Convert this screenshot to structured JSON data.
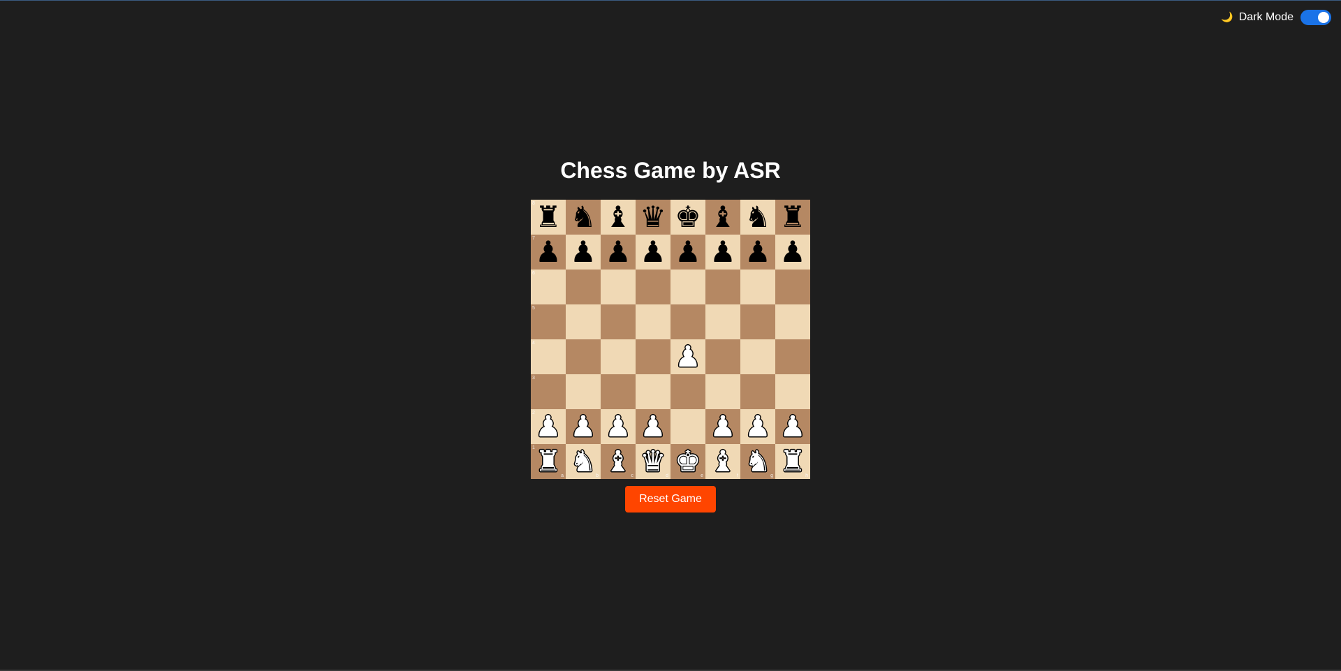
{
  "header": {
    "theme_icon": "moon-icon",
    "theme_label": "Dark Mode",
    "dark_mode_on": true,
    "toggle_color": "#1a73e8"
  },
  "game": {
    "title": "Chess Game by ASR",
    "reset_label": "Reset Game",
    "reset_color": "#ff4500",
    "light_square_color": "#f0d9b5",
    "dark_square_color": "#b58863",
    "ranks": [
      "8",
      "7",
      "6",
      "5",
      "4",
      "3",
      "2",
      "1"
    ],
    "files": [
      "a",
      "b",
      "c",
      "d",
      "e",
      "f",
      "g",
      "h"
    ],
    "position": [
      [
        "bR",
        "bN",
        "bB",
        "bQ",
        "bK",
        "bB",
        "bN",
        "bR"
      ],
      [
        "bP",
        "bP",
        "bP",
        "bP",
        "bP",
        "bP",
        "bP",
        "bP"
      ],
      [
        "",
        "",
        "",
        "",
        "",
        "",
        "",
        ""
      ],
      [
        "",
        "",
        "",
        "",
        "",
        "",
        "",
        ""
      ],
      [
        "",
        "",
        "",
        "",
        "wP",
        "",
        "",
        ""
      ],
      [
        "",
        "",
        "",
        "",
        "",
        "",
        "",
        ""
      ],
      [
        "wP",
        "wP",
        "wP",
        "wP",
        "",
        "wP",
        "wP",
        "wP"
      ],
      [
        "wR",
        "wN",
        "wB",
        "wQ",
        "wK",
        "wB",
        "wN",
        "wR"
      ]
    ]
  }
}
